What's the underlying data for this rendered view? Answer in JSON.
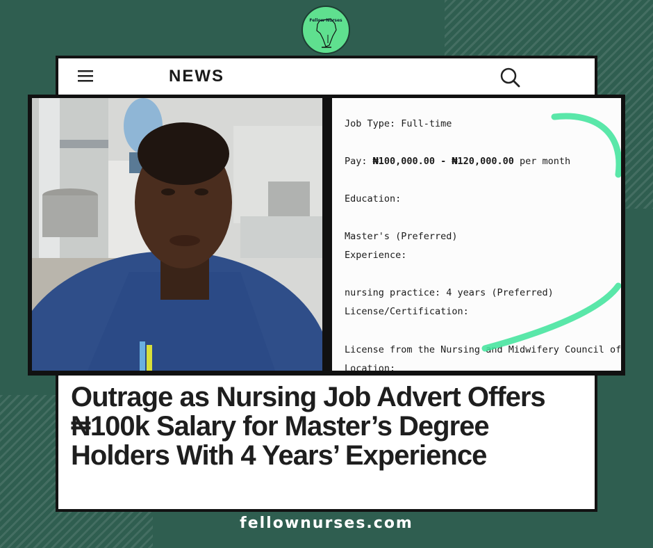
{
  "brand": {
    "logo_text": "Fellow Nurses",
    "logo_color": "#5fe08f",
    "background_color": "#2f5e50",
    "website": "fellownurses.com"
  },
  "header": {
    "section_title": "NEWS",
    "menu_icon": "hamburger-menu-icon",
    "search_icon": "search-icon"
  },
  "advert": {
    "job_type": "Job Type: Full-time",
    "pay_label": "Pay: ",
    "pay_value": "₦100,000.00 - ₦120,000.00",
    "pay_suffix": " per month",
    "education_label": "Education:",
    "education_value": "Master's (Preferred)",
    "experience_label": "Experience:",
    "experience_value": "nursing practice: 4 years (Preferred)",
    "license_label": "License/Certification:",
    "license_value": "License from the Nursing and Midwifery Council of Nigeria",
    "location_label": "Location:",
    "highlight_color": "#3de39a"
  },
  "article": {
    "headline": "Outrage as Nursing Job Advert Offers ₦100k Salary for Master’s Degree Holders With 4 Years’ Experience"
  }
}
